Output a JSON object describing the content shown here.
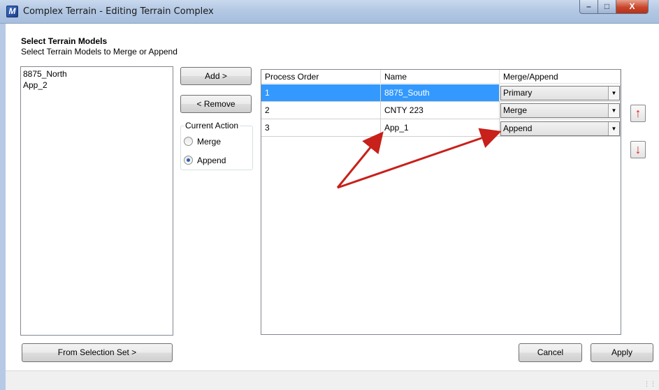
{
  "window": {
    "title": "Complex Terrain - Editing Terrain Complex",
    "minimize_label": "–",
    "maximize_label": "□",
    "close_label": "X",
    "app_icon_glyph": "M"
  },
  "header": {
    "title": "Select Terrain Models",
    "subtitle": "Select Terrain Models to Merge or Append"
  },
  "available_models": [
    "8875_North",
    "App_2"
  ],
  "buttons": {
    "add": "Add >",
    "remove": "< Remove",
    "from_selection_set": "From Selection Set >",
    "cancel": "Cancel",
    "apply": "Apply",
    "move_up_glyph": "↑",
    "move_down_glyph": "↓"
  },
  "current_action": {
    "label": "Current Action",
    "options": [
      "Merge",
      "Append"
    ],
    "selected": "Append"
  },
  "grid": {
    "columns": [
      "Process Order",
      "Name",
      "Merge/Append"
    ],
    "rows": [
      {
        "order": "1",
        "name": "8875_South",
        "mode": "Primary",
        "selected": true
      },
      {
        "order": "2",
        "name": "CNTY 223",
        "mode": "Merge",
        "selected": false
      },
      {
        "order": "3",
        "name": "App_1",
        "mode": "Append",
        "selected": false
      }
    ]
  },
  "colors": {
    "selection": "#3399ff",
    "annotation_arrow": "#c8201a",
    "title_bar": "#b3c8e3"
  },
  "icons": {
    "app": "terrain-app-icon",
    "move_up": "arrow-up-icon",
    "move_down": "arrow-down-icon",
    "dropdown": "chevron-down-icon"
  }
}
